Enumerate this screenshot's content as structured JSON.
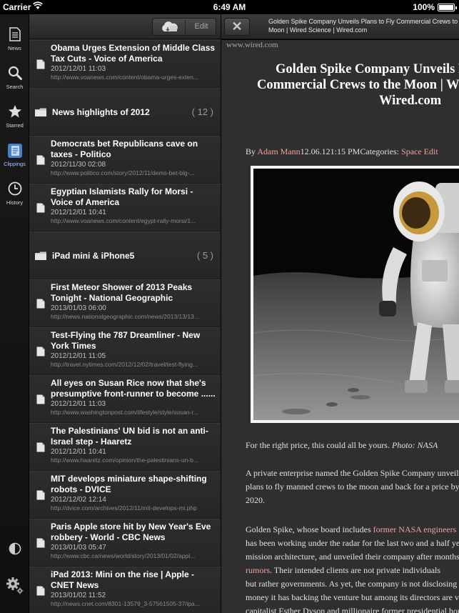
{
  "status_bar": {
    "carrier": "Carrier",
    "time": "6:49 AM",
    "battery": "100%"
  },
  "tab_bar": {
    "tabs": [
      {
        "label": "News",
        "icon": "news-icon"
      },
      {
        "label": "Search",
        "icon": "search-icon"
      },
      {
        "label": "Starred",
        "icon": "star-icon"
      },
      {
        "label": "Clippings",
        "icon": "clippings-icon",
        "active": true
      },
      {
        "label": "History",
        "icon": "history-icon"
      }
    ]
  },
  "list_toolbar": {
    "edit_label": "Edit"
  },
  "clippings": [
    {
      "type": "article",
      "title": "Obama Urges Extension of Middle Class Tax Cuts - Voice of America",
      "date": "2012/12/01 11:03",
      "url": "http://www.voanews.com/content/obama-urges-exten..."
    },
    {
      "type": "folder",
      "title": "News highlights of 2012",
      "count": "( 12 )"
    },
    {
      "type": "article",
      "title": "Democrats bet Republicans cave on taxes - Politico",
      "date": "2012/11/30 02:08",
      "url": "http://www.politico.com/story/2012/11/dems-bet-big-..."
    },
    {
      "type": "article",
      "title": "Egyptian Islamists Rally for Morsi - Voice of America",
      "date": "2012/12/01 10:41",
      "url": "http://www.voanews.com/content/egypt-rally-morsi/1..."
    },
    {
      "type": "folder",
      "title": "iPad mini & iPhone5",
      "count": "( 5 )"
    },
    {
      "type": "article",
      "title": "First Meteor Shower of 2013 Peaks Tonight - National Geographic",
      "date": "2013/01/03 06:00",
      "url": "http://news.nationalgeographic.com/news/2013/13/13..."
    },
    {
      "type": "article",
      "title": "Test-Flying the 787 Dreamliner - New York Times",
      "date": "2012/12/01 11:05",
      "url": "http://travel.nytimes.com/2012/12/02/travel/test-flying..."
    },
    {
      "type": "article",
      "title": "All eyes on Susan Rice now that she's presumptive front-runner to become ......",
      "date": "2012/12/01 11:03",
      "url": "http://www.washingtonpost.com/lifestyle/style/susan-r..."
    },
    {
      "type": "article",
      "title": "The Palestinians' UN bid is not an anti-Israel step - Haaretz",
      "date": "2012/12/01 10:41",
      "url": "http://www.haaretz.com/opinion/the-palestinians-un-b..."
    },
    {
      "type": "article",
      "title": "MIT develops miniature shape-shifting robots - DVICE",
      "date": "2012/12/02 12:14",
      "url": "http://dvice.com/archives/2012/11/mit-develops-mi.php"
    },
    {
      "type": "article",
      "title": "Paris Apple store hit by New Year's Eve robbery - World - CBC News",
      "date": "2013/01/03 05:47",
      "url": "http://www.cbc.ca/news/world/story/2013/01/02/appl..."
    },
    {
      "type": "article",
      "title": "iPad 2013: Mini on the rise | Apple - CNET News",
      "date": "2013/01/02 11:52",
      "url": "http://news.cnet.com/8301-13579_3-57561505-37/ipa..."
    }
  ],
  "article": {
    "toolbar_title_line1": "Golden Spike Company Unveils Plans to Fly Commercial Crews to the",
    "toolbar_title_line2": "Moon | Wired Science | Wired.com",
    "source": "www.wired.com",
    "headline_lines": [
      "Golden Spike Company Unveils Plans to Fly",
      "Commercial Crews to the Moon | Wired Science |",
      "Wired.com"
    ],
    "byline_prefix": "By ",
    "author": "Adam Mann",
    "byline_date": "12.06.12",
    "byline_time": "1:15 PM",
    "byline_categories_label": "Categories: ",
    "category": "Space",
    "edit_link": "Edit",
    "caption": "For the right price, this could all be yours. ",
    "caption_credit": "Photo: NASA",
    "paragraph1_lines": [
      "A private enterprise named the Golden Spike Company unveiled",
      "plans to fly manned crews to the moon and back for a price by",
      "2020."
    ],
    "paragraph2_start": "Golden Spike, whose board includes ",
    "paragraph2_link": "former NASA engineers",
    "paragraph2_lines": [
      "has been working under the radar for the last two and a half years on a",
      "mission architecture, and unveiled their company after months of"
    ],
    "paragraph2_link2": "rumors",
    "paragraph2_after_link2": ". Their intended clients are not private individuals",
    "paragraph2_more_lines": [
      "but rather governments. As yet, the company is not disclosing how much",
      "money it has backing the venture but among its directors are venture",
      "capitalist Esther Dyson and millionaire former presidential hopeful"
    ]
  }
}
